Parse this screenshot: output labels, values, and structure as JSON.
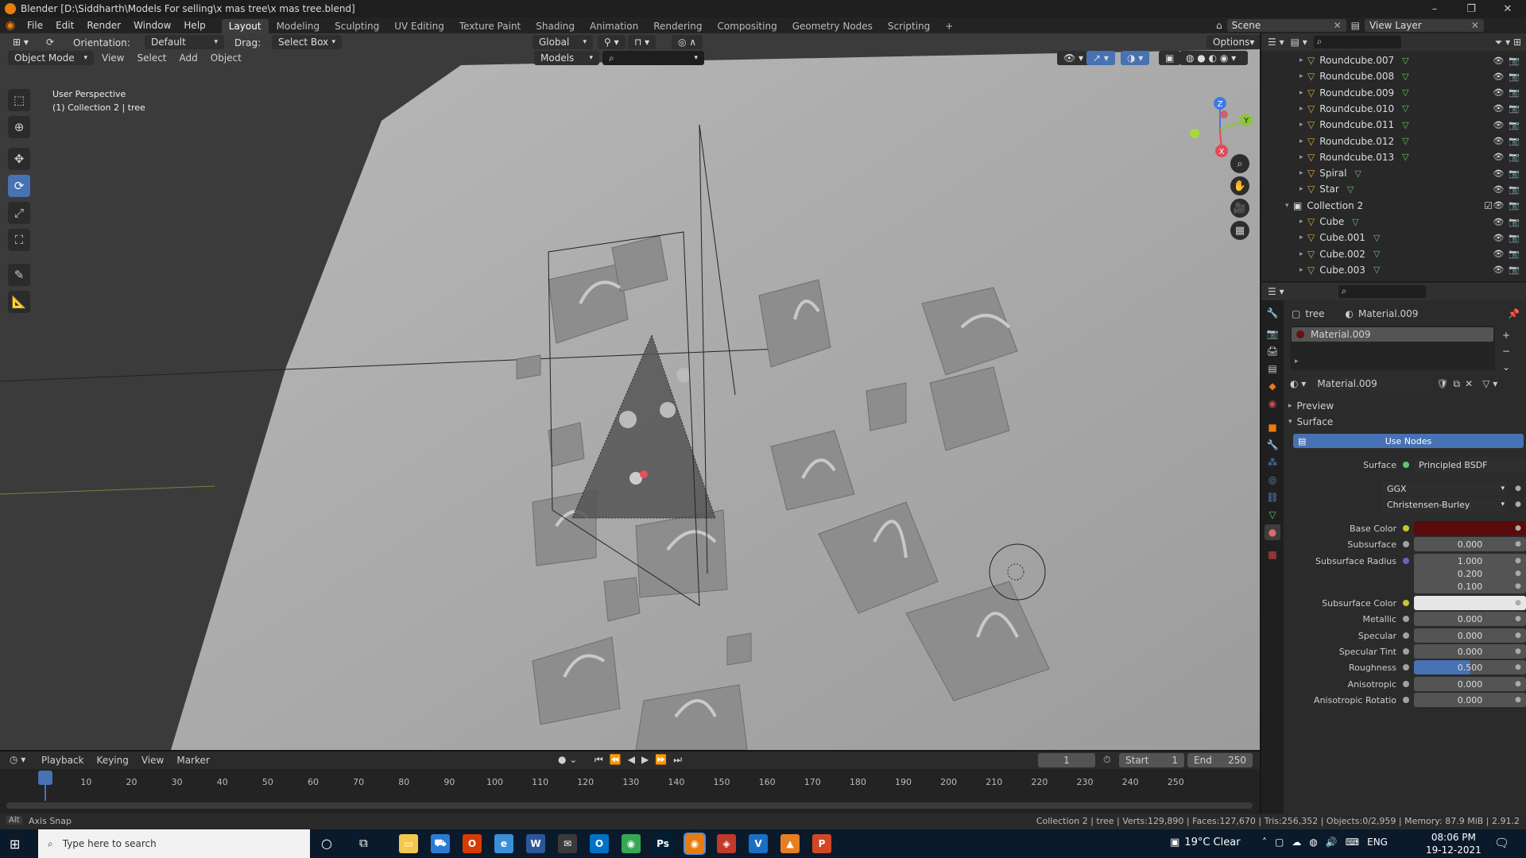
{
  "titlebar": {
    "title": "Blender [D:\\Siddharth\\Models For selling\\x mas tree\\x mas tree.blend]"
  },
  "menu": [
    "File",
    "Edit",
    "Render",
    "Window",
    "Help"
  ],
  "workspaces": [
    "Layout",
    "Modeling",
    "Sculpting",
    "UV Editing",
    "Texture Paint",
    "Shading",
    "Animation",
    "Rendering",
    "Compositing",
    "Geometry Nodes",
    "Scripting",
    "+"
  ],
  "scene": {
    "scene_name": "Scene",
    "view_layer": "View Layer"
  },
  "viewport_header": {
    "orientation_label": "Orientation:",
    "orientation_value": "Default",
    "drag_label": "Drag:",
    "drag_value": "Select Box",
    "transform_space": "Global",
    "options": "Options",
    "mode": "Object Mode",
    "menus": [
      "View",
      "Select",
      "Add",
      "Object"
    ],
    "collection_filter": "Models"
  },
  "viewport_overlay": {
    "perspective": "User Perspective",
    "context": "(1) Collection 2 | tree"
  },
  "gizmo": {
    "x": "X",
    "y": "Y",
    "z": "Z"
  },
  "outliner": {
    "rows": [
      {
        "name": "Roundcube.007",
        "indent": 2,
        "kind": "mesh"
      },
      {
        "name": "Roundcube.008",
        "indent": 2,
        "kind": "mesh"
      },
      {
        "name": "Roundcube.009",
        "indent": 2,
        "kind": "mesh"
      },
      {
        "name": "Roundcube.010",
        "indent": 2,
        "kind": "mesh"
      },
      {
        "name": "Roundcube.011",
        "indent": 2,
        "kind": "mesh"
      },
      {
        "name": "Roundcube.012",
        "indent": 2,
        "kind": "mesh"
      },
      {
        "name": "Roundcube.013",
        "indent": 2,
        "kind": "mesh"
      },
      {
        "name": "Spiral",
        "indent": 2,
        "kind": "mesh"
      },
      {
        "name": "Star",
        "indent": 2,
        "kind": "mesh"
      },
      {
        "name": "Collection 2",
        "indent": 1,
        "kind": "collection"
      },
      {
        "name": "Cube",
        "indent": 2,
        "kind": "mesh"
      },
      {
        "name": "Cube.001",
        "indent": 2,
        "kind": "mesh"
      },
      {
        "name": "Cube.002",
        "indent": 2,
        "kind": "mesh"
      },
      {
        "name": "Cube.003",
        "indent": 2,
        "kind": "mesh"
      }
    ]
  },
  "properties": {
    "breadcrumb_object": "tree",
    "breadcrumb_material": "Material.009",
    "slot_name": "Material.009",
    "material_name": "Material.009",
    "panel_preview": "Preview",
    "panel_surface": "Surface",
    "use_nodes": "Use Nodes",
    "surface_label": "Surface",
    "surface_value": "Principled BSDF",
    "distribution": "GGX",
    "subsurface_method": "Christensen-Burley",
    "fields": [
      {
        "label": "Base Color",
        "value": "",
        "dot": "#c7c729",
        "swatch": "#5a0b0b"
      },
      {
        "label": "Subsurface",
        "value": "0.000",
        "dot": "#a1a1a1"
      },
      {
        "label": "Subsurface Radius",
        "value": "1.000",
        "dot": "#6363c7"
      },
      {
        "label": "",
        "value": "0.200",
        "dot": ""
      },
      {
        "label": "",
        "value": "0.100",
        "dot": ""
      },
      {
        "label": "Subsurface Color",
        "value": "",
        "dot": "#c7c729",
        "swatch": "#e6e6e6"
      },
      {
        "label": "Metallic",
        "value": "0.000",
        "dot": "#a1a1a1"
      },
      {
        "label": "Specular",
        "value": "0.000",
        "dot": "#a1a1a1"
      },
      {
        "label": "Specular Tint",
        "value": "0.000",
        "dot": "#a1a1a1"
      },
      {
        "label": "Roughness",
        "value": "0.500",
        "dot": "#a1a1a1",
        "fill": 0.5
      },
      {
        "label": "Anisotropic",
        "value": "0.000",
        "dot": "#a1a1a1"
      },
      {
        "label": "Anisotropic Rotatio",
        "value": "0.000",
        "dot": "#a1a1a1"
      }
    ]
  },
  "timeline": {
    "menus": [
      "Playback",
      "Keying",
      "View",
      "Marker"
    ],
    "current_frame": "1",
    "start_label": "Start",
    "start": "1",
    "end_label": "End",
    "end": "250",
    "ticks": [
      "1",
      "10",
      "20",
      "30",
      "40",
      "50",
      "60",
      "70",
      "80",
      "90",
      "100",
      "110",
      "120",
      "130",
      "140",
      "150",
      "160",
      "170",
      "180",
      "190",
      "200",
      "210",
      "220",
      "230",
      "240",
      "250"
    ]
  },
  "statusbar": {
    "left": "Axis Snap",
    "key": "Alt",
    "right": "Collection 2 | tree | Verts:129,890 | Faces:127,670 | Tris:256,352 | Objects:0/2,959 | Memory: 87.9 MiB | 2.91.2"
  },
  "taskbar": {
    "search_placeholder": "Type here to search",
    "weather": "19°C  Clear",
    "lang": "ENG",
    "time": "08:06 PM",
    "date": "19-12-2021",
    "apps": [
      "file-explorer",
      "store",
      "office",
      "edge-legacy",
      "word",
      "mail",
      "outlook",
      "chrome",
      "photoshop",
      "blender",
      "app-red",
      "vegas",
      "vlc",
      "powerpoint"
    ]
  },
  "colors": {
    "accent": "#4772b3",
    "viewport_bg": "#3a3a3a",
    "taskbar_bg": "#0b1a2b"
  }
}
